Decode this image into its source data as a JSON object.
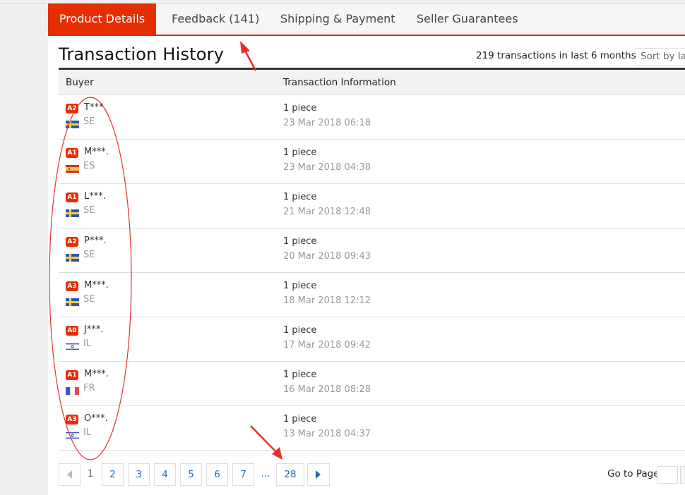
{
  "tabs": [
    {
      "label": "Product Details",
      "active": true
    },
    {
      "label": "Feedback (141)",
      "active": false
    },
    {
      "label": "Shipping & Payment",
      "active": false
    },
    {
      "label": "Seller Guarantees",
      "active": false
    }
  ],
  "section": {
    "title": "Transaction History",
    "summary": "219 transactions in last 6 months.",
    "sort_label": "Sort by latest"
  },
  "table": {
    "columns": [
      "Buyer",
      "Transaction Information"
    ],
    "rows": [
      {
        "level": "A2",
        "buyer": "T***.",
        "country": "SE",
        "flag": "sweden-flag-icon",
        "quantity": "1 piece",
        "date": "23 Mar 2018 06:18"
      },
      {
        "level": "A1",
        "buyer": "M***.",
        "country": "ES",
        "flag": "spain-flag-icon",
        "quantity": "1 piece",
        "date": "23 Mar 2018 04:38"
      },
      {
        "level": "A1",
        "buyer": "L***.",
        "country": "SE",
        "flag": "sweden-flag-icon",
        "quantity": "1 piece",
        "date": "21 Mar 2018 12:48"
      },
      {
        "level": "A2",
        "buyer": "P***.",
        "country": "SE",
        "flag": "sweden-flag-icon",
        "quantity": "1 piece",
        "date": "20 Mar 2018 09:43"
      },
      {
        "level": "A3",
        "buyer": "M***.",
        "country": "SE",
        "flag": "sweden-flag-icon",
        "quantity": "1 piece",
        "date": "18 Mar 2018 12:12"
      },
      {
        "level": "A0",
        "buyer": "J***.",
        "country": "IL",
        "flag": "israel-flag-icon",
        "quantity": "1 piece",
        "date": "17 Mar 2018 09:42"
      },
      {
        "level": "A1",
        "buyer": "M***.",
        "country": "FR",
        "flag": "france-flag-icon",
        "quantity": "1 piece",
        "date": "16 Mar 2018 08:28"
      },
      {
        "level": "A3",
        "buyer": "O***.",
        "country": "IL",
        "flag": "israel-flag-icon",
        "quantity": "1 piece",
        "date": "13 Mar 2018 04:37"
      }
    ]
  },
  "pagination": {
    "prev_icon": "chevron-left-icon",
    "current": "1",
    "pages": [
      "2",
      "3",
      "4",
      "5",
      "6",
      "7"
    ],
    "ellipsis": "...",
    "last": "28",
    "next_icon": "chevron-right-icon",
    "goto_label": "Go to Page",
    "goto_value": ""
  },
  "colors": {
    "accent": "#e62e04",
    "link": "#1e6bbf",
    "annotation": "#e8302a"
  }
}
